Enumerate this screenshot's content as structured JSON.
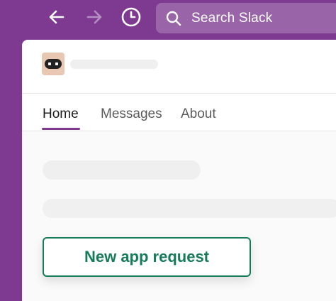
{
  "topbar": {
    "search_placeholder": "Search Slack",
    "icons": {
      "back": "arrow-left-icon",
      "forward": "arrow-right-icon",
      "history": "clock-icon",
      "search": "search-icon"
    }
  },
  "app": {
    "avatar_icon": "robot-icon"
  },
  "tabs": [
    {
      "label": "Home",
      "active": true
    },
    {
      "label": "Messages",
      "active": false
    },
    {
      "label": "About",
      "active": false
    }
  ],
  "content": {
    "new_request_label": "New app request"
  },
  "colors": {
    "sidebar_purple": "#7d3a90",
    "accent_green": "#167b5a",
    "active_tab_underline": "#7d3a90"
  }
}
